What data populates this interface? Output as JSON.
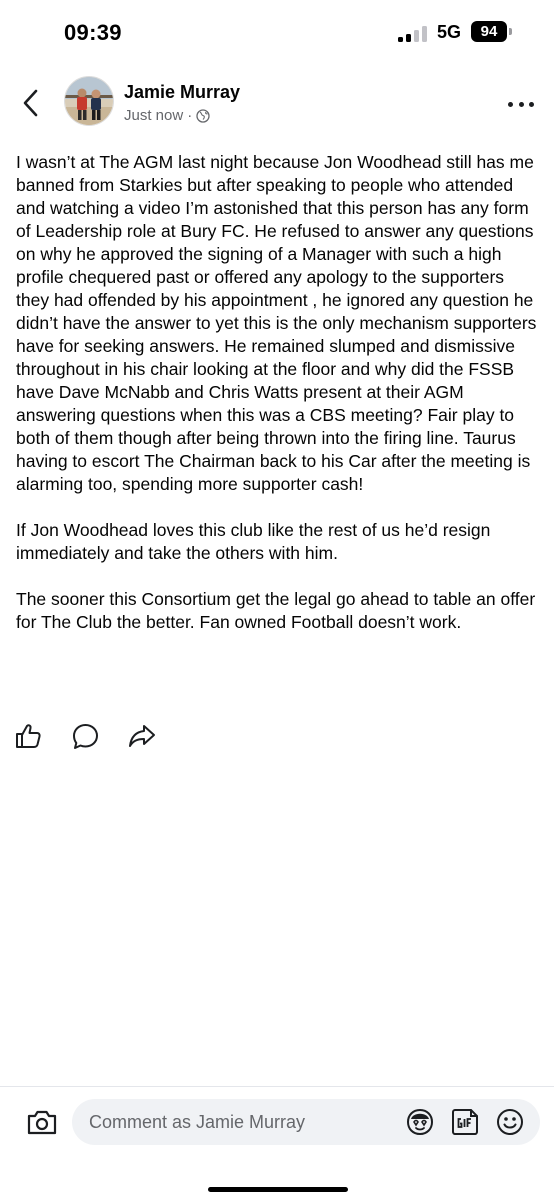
{
  "status_bar": {
    "time": "09:39",
    "network": "5G",
    "battery": "94"
  },
  "post": {
    "author": "Jamie Murray",
    "timestamp": "Just now",
    "separator": "·",
    "audience_icon": "globe-icon",
    "paragraphs": [
      "I wasn’t at The AGM last night because Jon Woodhead still has me banned from Starkies but after speaking to people who attended and watching a video I’m astonished that this person has any form of Leadership role at Bury FC. He refused to answer any questions on why he approved the signing of a Manager with such a high profile chequered past or offered any apology to the supporters they had offended by his appointment , he ignored any question he didn’t have the answer to yet this is the only mechanism supporters have for seeking answers. He remained slumped and dismissive throughout in his chair looking at the floor and why did the FSSB have Dave McNabb and Chris Watts present at their AGM answering questions when this was a CBS meeting? Fair play to both of them though after being thrown into the firing line. Taurus having to escort The Chairman back to his Car after the meeting is alarming too, spending more supporter cash!",
      "If Jon Woodhead loves this club like the rest of us he’d resign immediately and take the others with him.",
      "The sooner this Consortium get the legal go ahead to table an offer for The Club the better. Fan owned Football doesn’t work."
    ],
    "actions": [
      "like-icon",
      "comment-icon",
      "share-icon"
    ]
  },
  "comment_bar": {
    "placeholder": "Comment as Jamie Murray",
    "icons": [
      "camera-icon",
      "avatar-sticker-icon",
      "gif-icon",
      "emoji-icon"
    ]
  }
}
